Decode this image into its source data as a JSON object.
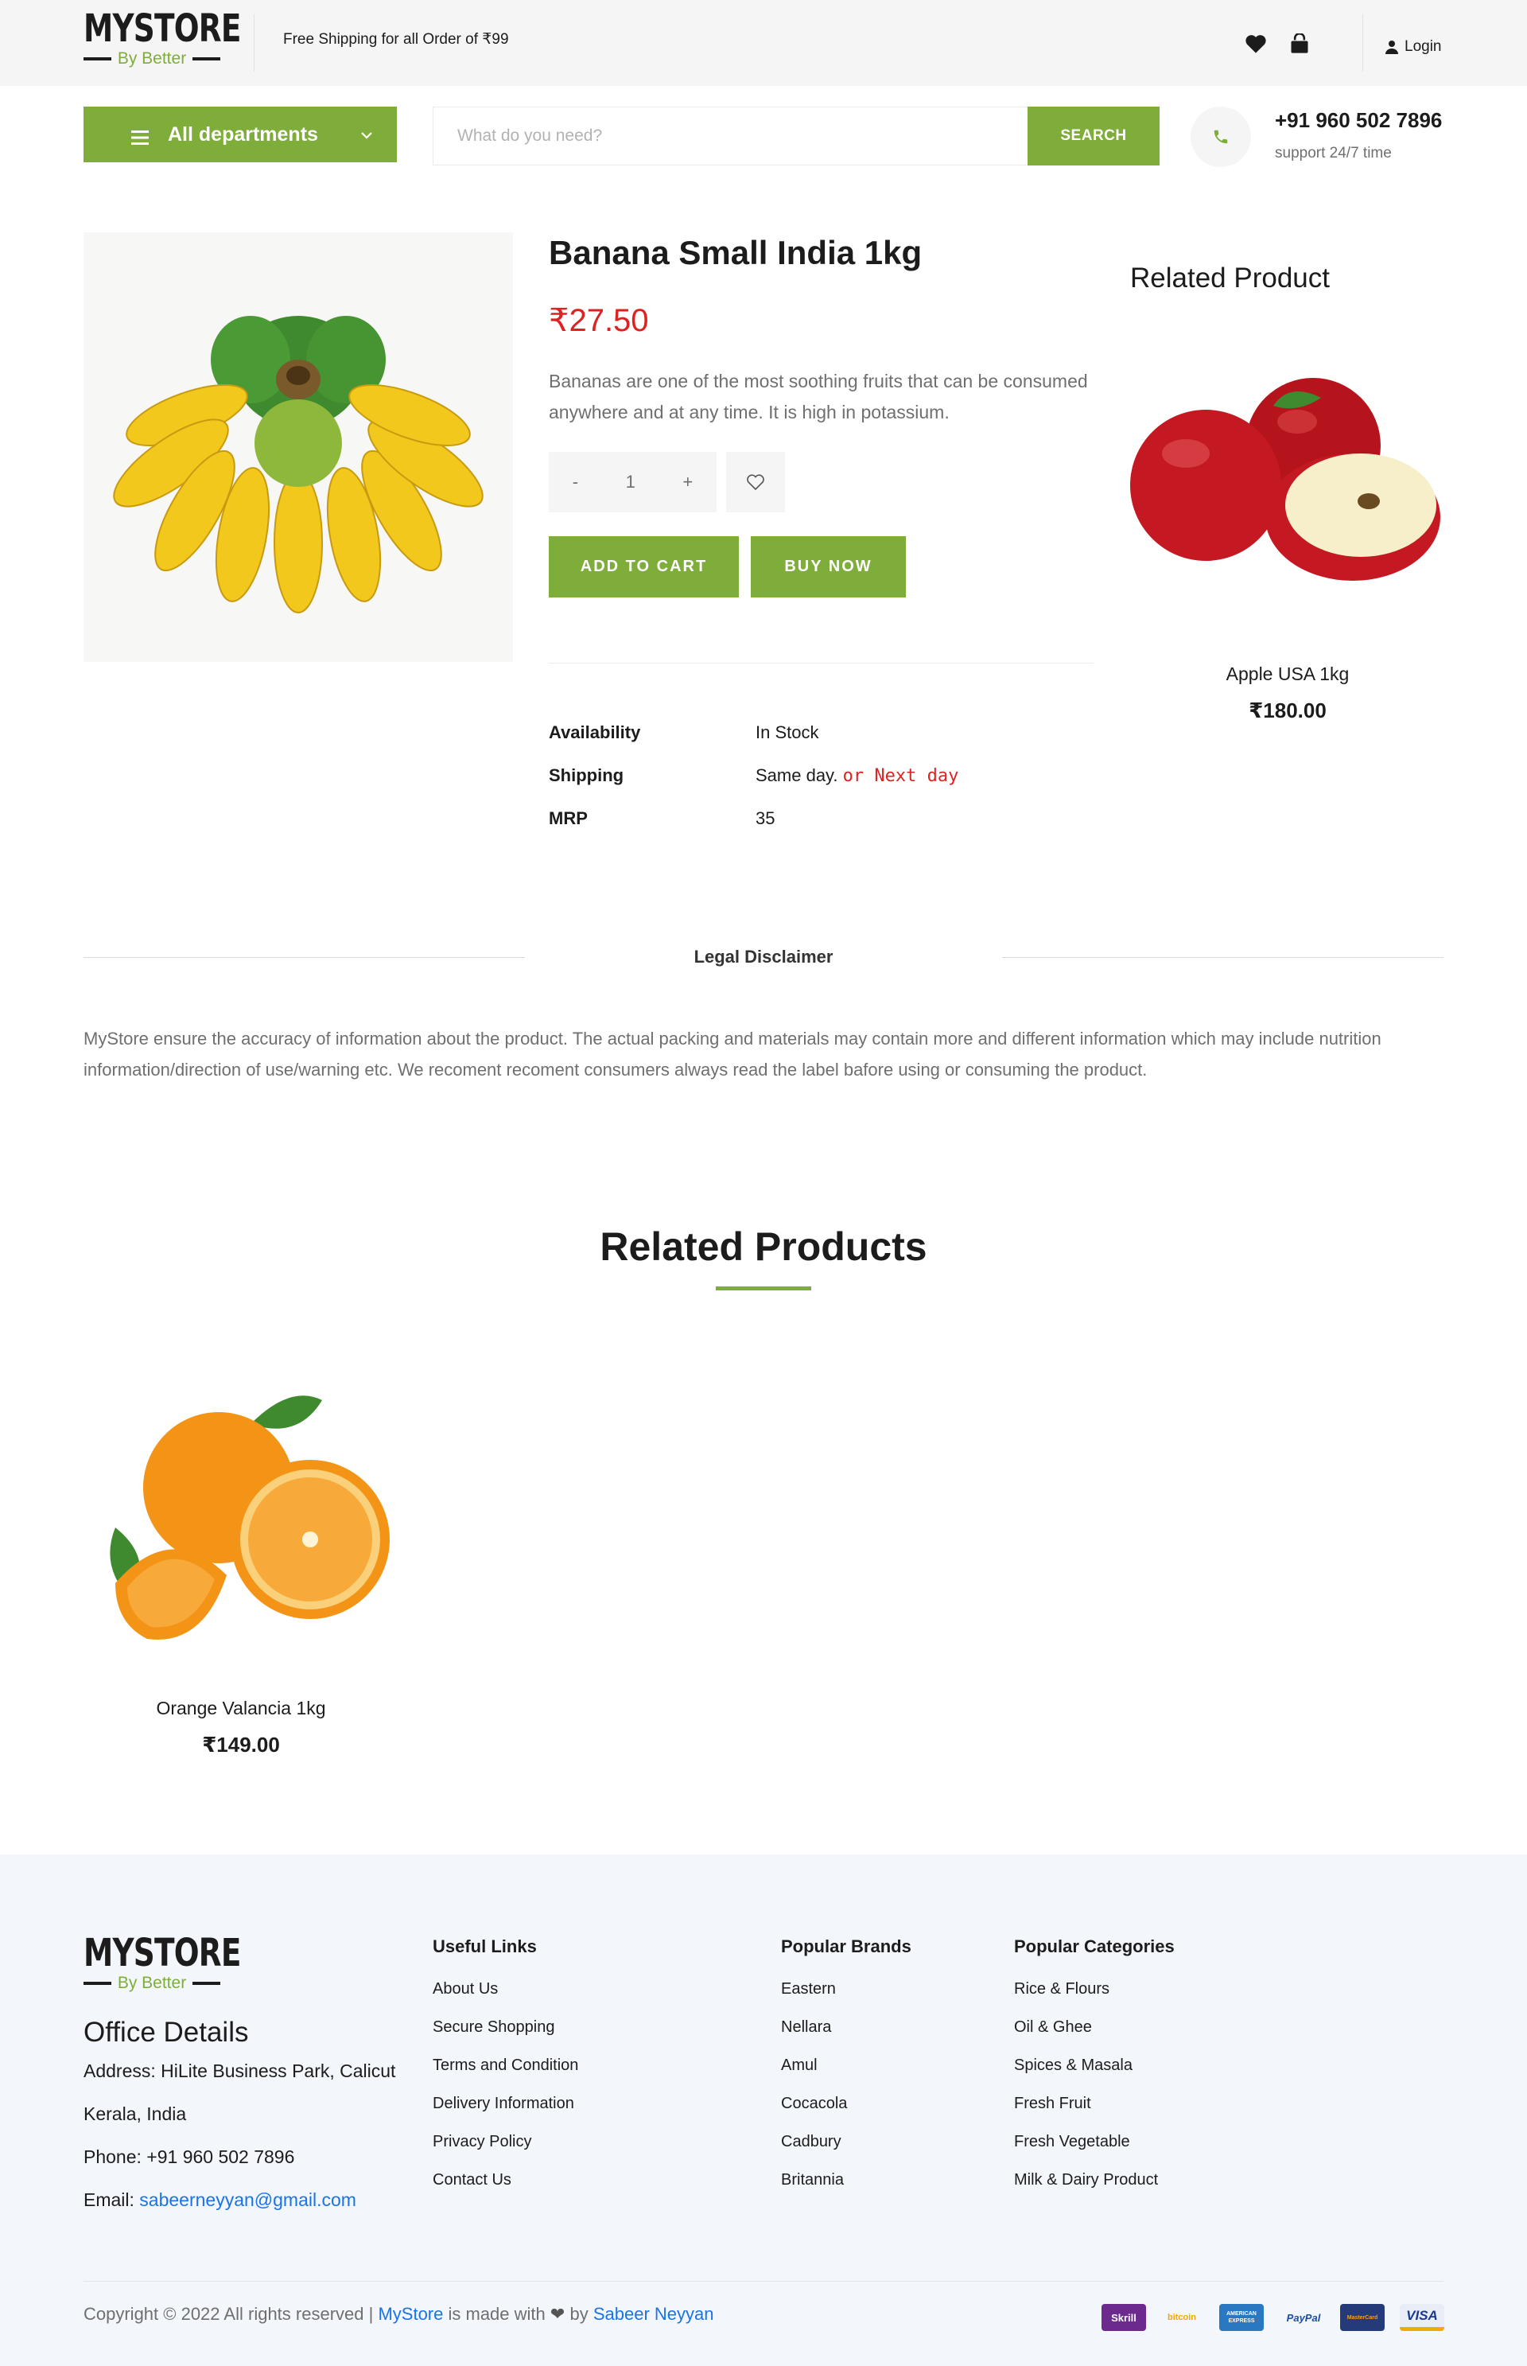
{
  "brand": {
    "name": "MYSTORE",
    "tagline": "By Better"
  },
  "topbar": {
    "shipping_note": "Free Shipping for all Order of ₹99",
    "login_label": "Login"
  },
  "search": {
    "department_label": "All departments",
    "placeholder": "What do you need?",
    "button_label": "SEARCH"
  },
  "contact": {
    "phone": "+91 960 502 7896",
    "support": "support 24/7 time"
  },
  "product": {
    "title": "Banana Small India 1kg",
    "price": "₹27.50",
    "description": "Bananas are one of the most soothing fruits that can be consumed anywhere and at any time. It is high in potassium.",
    "quantity": "1",
    "qty_minus": "-",
    "qty_plus": "+",
    "add_to_cart": "ADD TO CART",
    "buy_now": "BUY NOW",
    "specs": [
      {
        "label": "Availability",
        "value": "In Stock",
        "extra": ""
      },
      {
        "label": "Shipping",
        "value": "Same day.",
        "extra": "or Next day"
      },
      {
        "label": "MRP",
        "value": "35",
        "extra": ""
      }
    ]
  },
  "side_related": {
    "title": "Related Product",
    "item_name": "Apple USA 1kg",
    "item_price": "₹180.00"
  },
  "disclaimer": {
    "title": "Legal Disclaimer",
    "text": "MyStore ensure the accuracy of information about the product. The actual packing and materials may contain more and different information which may include nutrition information/direction of use/warning etc. We recoment recoment consumers always read the label bafore using or consuming the product."
  },
  "related_products": {
    "title": "Related Products",
    "items": [
      {
        "name": "Orange Valancia 1kg",
        "price": "₹149.00"
      }
    ]
  },
  "footer": {
    "office": {
      "title": "Office Details",
      "address": "Address: HiLite Business Park, Calicut",
      "region": "Kerala, India",
      "phone": "Phone: +91 960 502 7896",
      "email_label": "Email:",
      "email": "sabeerneyyan@gmail.com"
    },
    "useful_links": {
      "title": "Useful Links",
      "items": [
        "About Us",
        "Secure Shopping",
        "Terms and Condition",
        "Delivery Information",
        "Privacy Policy",
        "Contact Us"
      ]
    },
    "popular_brands": {
      "title": "Popular Brands",
      "items": [
        "Eastern",
        "Nellara",
        "Amul",
        "Cocacola",
        "Cadbury",
        "Britannia"
      ]
    },
    "popular_categories": {
      "title": "Popular Categories",
      "items": [
        "Rice & Flours",
        "Oil & Ghee",
        "Spices & Masala",
        "Fresh Fruit",
        "Fresh Vegetable",
        "Milk & Dairy Product"
      ]
    },
    "copyright": {
      "prefix": "Copyright © 2022 All rights reserved |",
      "store": "MyStore",
      "middle": "is made with",
      "by": "by",
      "author": "Sabeer Neyyan"
    },
    "payments": [
      "Skrill",
      "bitcoin",
      "AMERICAN EXPRESS",
      "PayPal",
      "MasterCard",
      "VISA"
    ]
  },
  "colors": {
    "accent": "#7fad39",
    "price": "#dd2222",
    "link": "#1a73e8",
    "footer_bg": "#f3f6fa"
  }
}
